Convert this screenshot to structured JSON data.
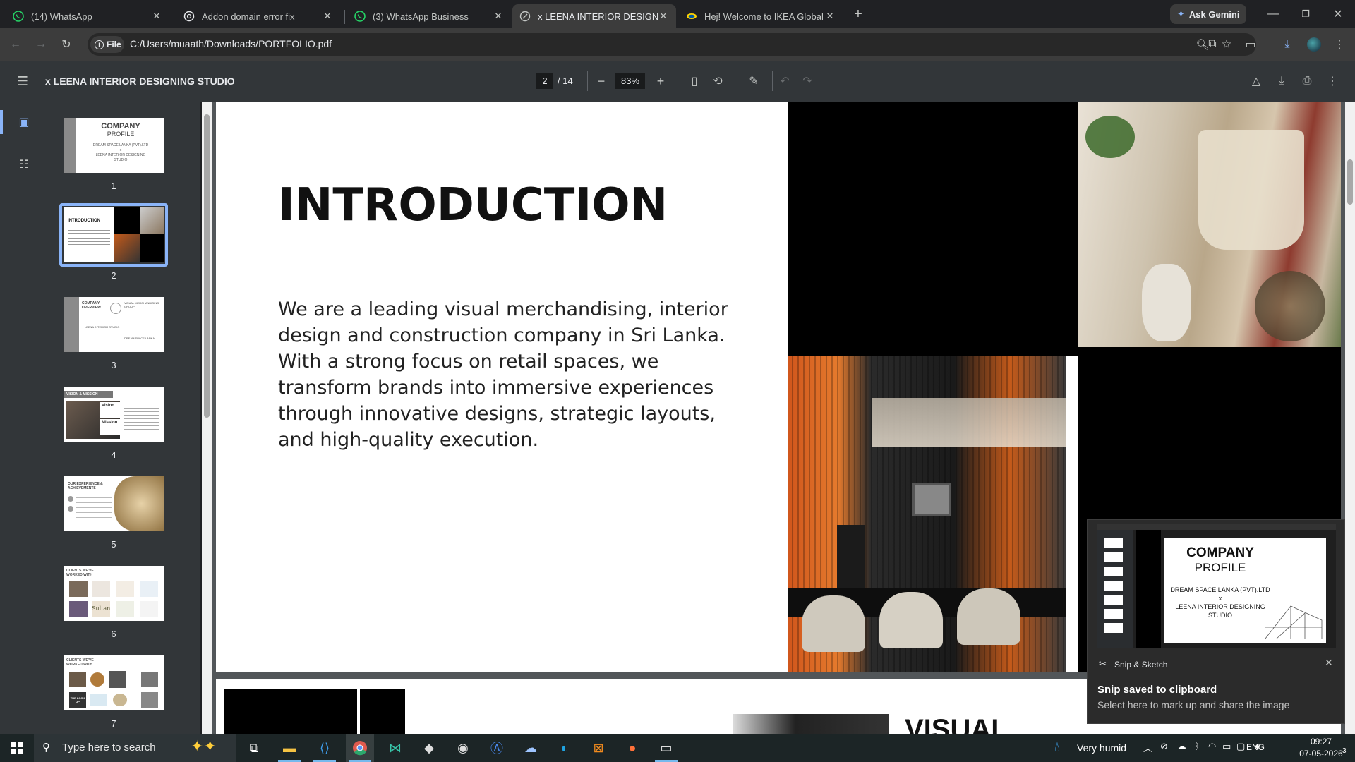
{
  "tabs": [
    {
      "title": "(14) WhatsApp",
      "icon": "whatsapp-icon"
    },
    {
      "title": "Addon domain error fix",
      "icon": "openai-icon"
    },
    {
      "title": "(3) WhatsApp Business",
      "icon": "whatsapp-icon"
    },
    {
      "title": "x LEENA INTERIOR DESIGNING",
      "icon": "globe-icon",
      "active": true
    },
    {
      "title": "Hej! Welcome to IKEA Global",
      "icon": "ikea-icon"
    }
  ],
  "gemini_label": "Ask Gemini",
  "omnibox": {
    "chip": "File",
    "url": "C:/Users/muaath/Downloads/PORTFOLIO.pdf"
  },
  "pdf": {
    "title": "x LEENA INTERIOR DESIGNING STUDIO",
    "page_current": "2",
    "page_total": "/ 14",
    "zoom": "83%"
  },
  "thumbnails": [
    {
      "num": "1",
      "title": "COMPANY",
      "sub": "PROFILE",
      "line1": "DREAM SPACE LANKA (PVT).LTD",
      "line2": "x",
      "line3": "LEENA INTERIOR DESIGNING",
      "line4": "STUDIO"
    },
    {
      "num": "2",
      "title": "INTRODUCTION"
    },
    {
      "num": "3",
      "title": "COMPANY OVERVIEW",
      "sub": "VISUAL MERCHANDISING GROUP",
      "line1": "LEENA INTERIOR STUDIO",
      "line2": "DREAM SPACE LANKA"
    },
    {
      "num": "4",
      "title": "VISION & MISSION",
      "sub": "Vision",
      "line1": "Mission"
    },
    {
      "num": "5",
      "title": "OUR EXPERIENCE & ACHIEVEMENTS"
    },
    {
      "num": "6",
      "title": "CLIENTS WE'VE WORKED WITH",
      "line1": "Sultan"
    },
    {
      "num": "7",
      "title": "CLIENTS WE'VE WORKED WITH",
      "line1": "THE LOCK UP"
    }
  ],
  "page2": {
    "heading": "INTRODUCTION",
    "body": "We are a leading visual merchandising, interior design and construction company in Sri Lanka. With a strong focus on retail spaces, we transform brands into immersive experiences through innovative designs, strategic layouts, and high-quality execution."
  },
  "page3_peek": "VISUAL",
  "snip": {
    "app": "Snip & Sketch",
    "title": "Snip saved to clipboard",
    "subtitle": "Select here to mark up and share the image",
    "preview_title": "COMPANY",
    "preview_sub": "PROFILE",
    "preview_l1": "DREAM SPACE LANKA (PVT).LTD",
    "preview_l2": "x",
    "preview_l3": "LEENA INTERIOR DESIGNING",
    "preview_l4": "STUDIO"
  },
  "taskbar": {
    "search_placeholder": "Type here to search",
    "weather": "Very humid",
    "lang": "ENG",
    "time": "09:27",
    "date": "07-05-2026",
    "notif_count": "3"
  },
  "colors": {
    "accent": "#8ab4f8",
    "whatsapp": "#25d366",
    "thumb_selected": "#8ab4f8"
  }
}
